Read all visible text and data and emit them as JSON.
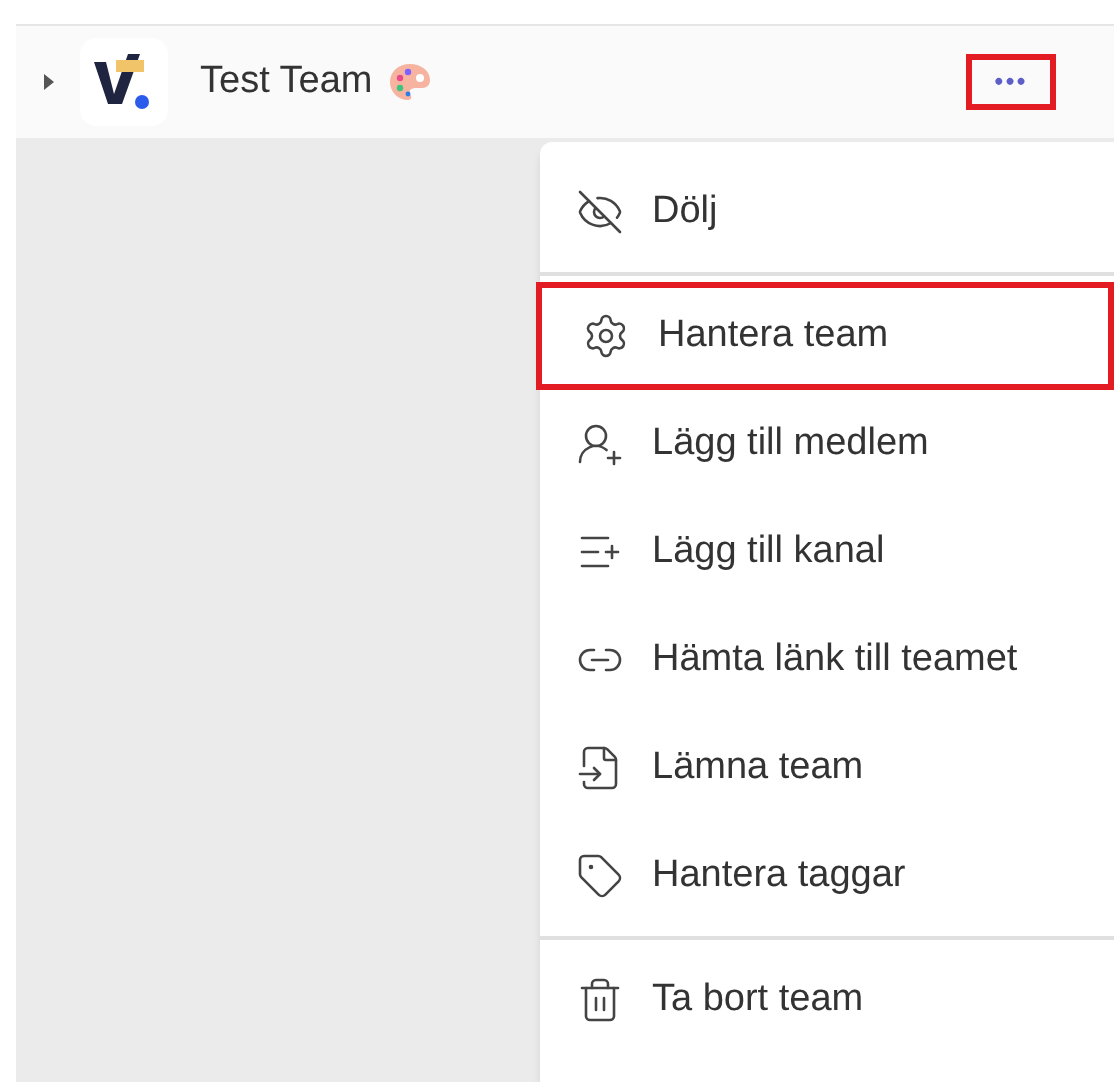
{
  "team": {
    "name": "Test Team",
    "expanded": false,
    "more_button": {
      "label": "•••",
      "highlighted": true
    }
  },
  "menu": {
    "items": [
      {
        "kind": "hide",
        "label": "Dölj",
        "highlighted": false,
        "divider_after": true
      },
      {
        "kind": "manage",
        "label": "Hantera team",
        "highlighted": true,
        "divider_after": false
      },
      {
        "kind": "add_member",
        "label": "Lägg till medlem",
        "highlighted": false,
        "divider_after": false
      },
      {
        "kind": "add_channel",
        "label": "Lägg till kanal",
        "highlighted": false,
        "divider_after": false
      },
      {
        "kind": "link",
        "label": "Hämta länk till teamet",
        "highlighted": false,
        "divider_after": false
      },
      {
        "kind": "leave",
        "label": "Lämna team",
        "highlighted": false,
        "divider_after": false
      },
      {
        "kind": "tags",
        "label": "Hantera taggar",
        "highlighted": false,
        "divider_after": true
      },
      {
        "kind": "delete",
        "label": "Ta bort team",
        "highlighted": false,
        "divider_after": false
      }
    ]
  }
}
